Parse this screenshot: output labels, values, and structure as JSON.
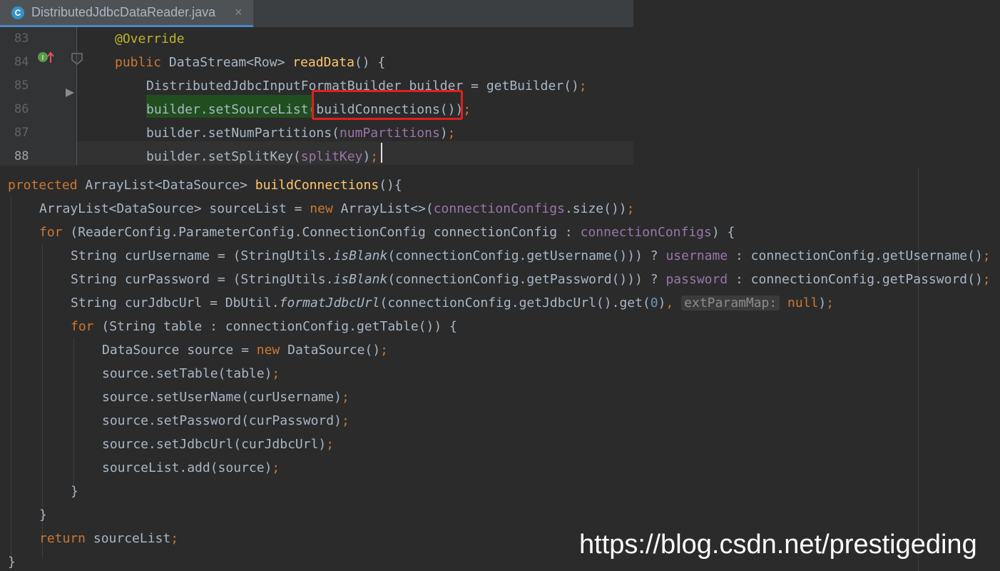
{
  "tab": {
    "icon": "C",
    "title": "DistributedJdbcDataReader.java",
    "close": "×"
  },
  "top_code": {
    "lines": [
      {
        "num": "83",
        "parts": [
          [
            "an",
            "@Override"
          ]
        ]
      },
      {
        "num": "84",
        "parts": [
          [
            "kw",
            "public "
          ],
          [
            "tx",
            "DataStream<Row> "
          ],
          [
            "fn",
            "readData"
          ],
          [
            "tx",
            "() {"
          ]
        ]
      },
      {
        "num": "85",
        "parts": [
          [
            "tx",
            "DistributedJdbcInputFormatBuilder builder = getBuilder()"
          ],
          [
            "kw",
            ";"
          ]
        ]
      },
      {
        "num": "86",
        "parts": [
          [
            "tx",
            "builder.setSourceList(buildConnections())"
          ],
          [
            "kw",
            ";"
          ]
        ]
      },
      {
        "num": "87",
        "parts": [
          [
            "tx",
            "builder.setNumPartitions("
          ],
          [
            "fd",
            "numPartitions"
          ],
          [
            "tx",
            ")"
          ],
          [
            "kw",
            ";"
          ]
        ]
      },
      {
        "num": "88",
        "parts": [
          [
            "tx",
            "builder.setSplitKey("
          ],
          [
            "fd",
            "splitKey"
          ],
          [
            "tx",
            ")"
          ],
          [
            "kw",
            ";"
          ]
        ]
      }
    ]
  },
  "bottom_code": {
    "lines": [
      {
        "indent": 0,
        "parts": [
          [
            "kw",
            "protected "
          ],
          [
            "tx",
            "ArrayList<DataSource> "
          ],
          [
            "fn",
            "buildConnections"
          ],
          [
            "tx",
            "(){"
          ]
        ]
      },
      {
        "indent": 1,
        "parts": [
          [
            "tx",
            "ArrayList<DataSource> sourceList = "
          ],
          [
            "kw",
            "new "
          ],
          [
            "tx",
            "ArrayList<>("
          ],
          [
            "fd",
            "connectionConfigs"
          ],
          [
            "tx",
            ".size())"
          ],
          [
            "kw",
            ";"
          ]
        ]
      },
      {
        "indent": 1,
        "parts": [
          [
            "kw",
            "for "
          ],
          [
            "tx",
            "(ReaderConfig.ParameterConfig.ConnectionConfig connectionConfig : "
          ],
          [
            "fd",
            "connectionConfigs"
          ],
          [
            "tx",
            ") {"
          ]
        ]
      },
      {
        "indent": 2,
        "parts": [
          [
            "tx",
            "String curUsername = (StringUtils."
          ],
          [
            "it",
            "isBlank"
          ],
          [
            "tx",
            "(connectionConfig.getUsername())) ? "
          ],
          [
            "fd",
            "username"
          ],
          [
            "tx",
            " : connectionConfig.getUsername()"
          ],
          [
            "kw",
            ";"
          ]
        ]
      },
      {
        "indent": 2,
        "parts": [
          [
            "tx",
            "String curPassword = (StringUtils."
          ],
          [
            "it",
            "isBlank"
          ],
          [
            "tx",
            "(connectionConfig.getPassword())) ? "
          ],
          [
            "fd",
            "password"
          ],
          [
            "tx",
            " : connectionConfig.getPassword()"
          ],
          [
            "kw",
            ";"
          ]
        ]
      },
      {
        "indent": 2,
        "parts": [
          [
            "tx",
            "String curJdbcUrl = DbUtil."
          ],
          [
            "it",
            "formatJdbcUrl"
          ],
          [
            "tx",
            "(connectionConfig.getJdbcUrl().get("
          ],
          [
            "nm",
            "0"
          ],
          [
            "tx",
            ")"
          ],
          [
            "kw",
            ", "
          ],
          [
            "hint",
            "extParamMap:"
          ],
          [
            "kw",
            " null"
          ],
          [
            "tx",
            ")"
          ],
          [
            "kw",
            ";"
          ]
        ]
      },
      {
        "indent": 2,
        "parts": [
          [
            "kw",
            "for "
          ],
          [
            "tx",
            "(String table : connectionConfig.getTable()) {"
          ]
        ]
      },
      {
        "indent": 3,
        "parts": [
          [
            "tx",
            "DataSource source = "
          ],
          [
            "kw",
            "new "
          ],
          [
            "tx",
            "DataSource()"
          ],
          [
            "kw",
            ";"
          ]
        ]
      },
      {
        "indent": 3,
        "parts": [
          [
            "tx",
            "source.setTable(table)"
          ],
          [
            "kw",
            ";"
          ]
        ]
      },
      {
        "indent": 3,
        "parts": [
          [
            "tx",
            "source.setUserName(curUsername)"
          ],
          [
            "kw",
            ";"
          ]
        ]
      },
      {
        "indent": 3,
        "parts": [
          [
            "tx",
            "source.setPassword(curPassword)"
          ],
          [
            "kw",
            ";"
          ]
        ]
      },
      {
        "indent": 3,
        "parts": [
          [
            "tx",
            "source.setJdbcUrl(curJdbcUrl)"
          ],
          [
            "kw",
            ";"
          ]
        ]
      },
      {
        "indent": 3,
        "parts": [
          [
            "tx",
            "sourceList.add(source)"
          ],
          [
            "kw",
            ";"
          ]
        ]
      },
      {
        "indent": 2,
        "parts": [
          [
            "tx",
            "}"
          ]
        ]
      },
      {
        "indent": 1,
        "parts": [
          [
            "tx",
            "}"
          ]
        ]
      },
      {
        "indent": 1,
        "parts": [
          [
            "kw",
            "return "
          ],
          [
            "tx",
            "sourceList"
          ],
          [
            "kw",
            ";"
          ]
        ]
      },
      {
        "indent": 0,
        "parts": [
          [
            "tx",
            "}"
          ]
        ]
      }
    ]
  },
  "watermark": "https://blog.csdn.net/prestigeding",
  "colors": {
    "keyword": "#cc7832",
    "text": "#a9b7c6",
    "method": "#ffc66d",
    "field": "#9876aa",
    "annotation": "#bbb529",
    "number": "#6897bb",
    "highlight": "#e02020"
  }
}
